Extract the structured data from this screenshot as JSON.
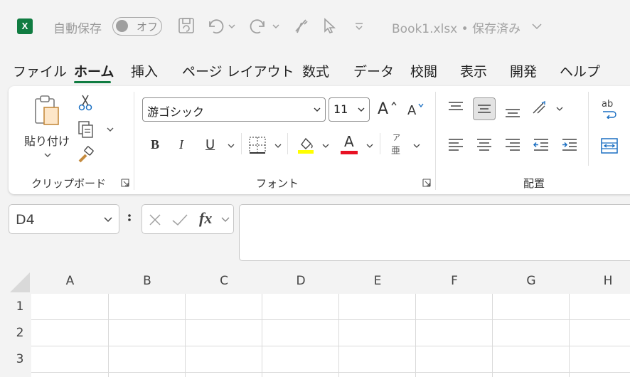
{
  "titlebar": {
    "app_logo": "X",
    "autosave_label": "自動保存",
    "autosave_toggle": "オフ",
    "document_title": "Book1.xlsx • 保存済み"
  },
  "tabs": [
    {
      "label": "ファイル"
    },
    {
      "label": "ホーム"
    },
    {
      "label": "挿入"
    },
    {
      "label": "ページ レイアウト"
    },
    {
      "label": "数式"
    },
    {
      "label": "データ"
    },
    {
      "label": "校閲"
    },
    {
      "label": "表示"
    },
    {
      "label": "開発"
    },
    {
      "label": "ヘルプ"
    }
  ],
  "active_tab": "ホーム",
  "ribbon": {
    "clipboard": {
      "paste_label": "貼り付け",
      "group_label": "クリップボード"
    },
    "font": {
      "font_name": "游ゴシック",
      "font_size": "11",
      "bold": "B",
      "italic": "I",
      "underline": "U",
      "font_color_glyph": "A",
      "grow_glyph": "A",
      "shrink_glyph": "A",
      "phonetic_top": "ア",
      "phonetic_bottom": "亜",
      "group_label": "フォント"
    },
    "alignment": {
      "group_label": "配置",
      "wrap_glyph": "ab"
    }
  },
  "formula_bar": {
    "name_box": "D4",
    "fx_label": "fx",
    "formula": ""
  },
  "grid": {
    "columns": [
      "A",
      "B",
      "C",
      "D",
      "E",
      "F",
      "G",
      "H"
    ],
    "rows": [
      "1",
      "2",
      "3"
    ]
  },
  "colors": {
    "excel_green": "#107c41",
    "highlight_yellow": "#ffff00",
    "font_red": "#e81123",
    "blue_icon": "#1a6fc2"
  }
}
